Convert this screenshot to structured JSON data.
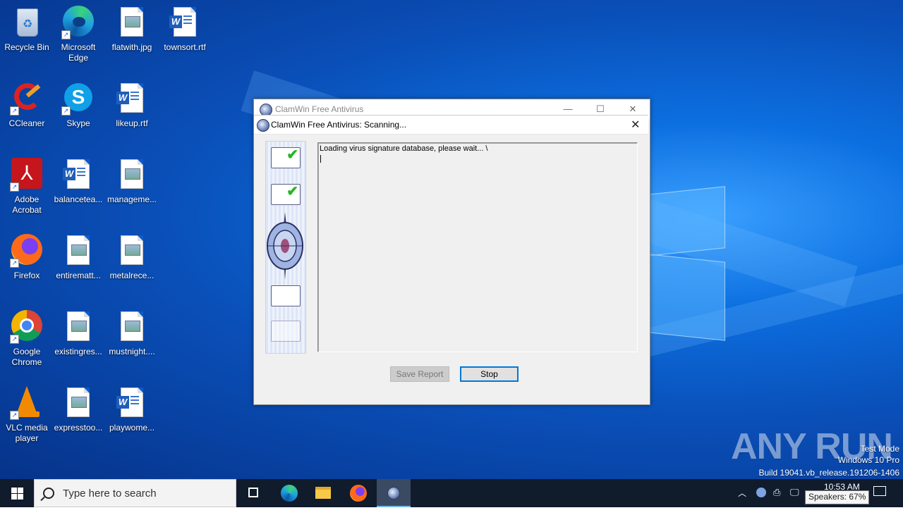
{
  "desktop": {
    "icons": [
      {
        "label": "Recycle Bin",
        "icon": "recycle-bin-icon"
      },
      {
        "label": "Microsoft Edge",
        "icon": "edge-icon"
      },
      {
        "label": "flatwith.jpg",
        "icon": "image-file-icon"
      },
      {
        "label": "townsort.rtf",
        "icon": "word-doc-icon"
      },
      {
        "label": "CCleaner",
        "icon": "ccleaner-icon"
      },
      {
        "label": "Skype",
        "icon": "skype-icon"
      },
      {
        "label": "likeup.rtf",
        "icon": "word-doc-icon"
      },
      {
        "label": "Adobe Acrobat",
        "icon": "acrobat-icon"
      },
      {
        "label": "balancetea...",
        "icon": "word-doc-icon"
      },
      {
        "label": "manageme...",
        "icon": "image-file-icon"
      },
      {
        "label": "Firefox",
        "icon": "firefox-icon"
      },
      {
        "label": "entirematt...",
        "icon": "image-file-icon"
      },
      {
        "label": "metalrece...",
        "icon": "image-file-icon"
      },
      {
        "label": "Google Chrome",
        "icon": "chrome-icon"
      },
      {
        "label": "existingres...",
        "icon": "image-file-icon"
      },
      {
        "label": "mustnight....",
        "icon": "image-file-icon"
      },
      {
        "label": "VLC media player",
        "icon": "vlc-icon"
      },
      {
        "label": "expresstoo...",
        "icon": "image-file-icon"
      },
      {
        "label": "playwome...",
        "icon": "word-doc-icon"
      }
    ]
  },
  "outer_window": {
    "title": "ClamWin Free Antivirus"
  },
  "dialog": {
    "title": "ClamWin Free Antivirus: Scanning...",
    "log_text": "Loading virus signature database, please wait... \\",
    "save_report_label": "Save Report",
    "stop_label": "Stop"
  },
  "watermark": {
    "brand": "ANY RUN",
    "line1": "Test Mode",
    "line2": "Windows 10 Pro",
    "line3": "Build 19041.vb_release.191206-1406"
  },
  "taskbar": {
    "search_placeholder": "Type here to search",
    "clock": "10:53 AM",
    "tooltip": "Speakers: 67%"
  },
  "colors": {
    "accent": "#0078d7",
    "taskbar_bg": "#101b2c"
  }
}
